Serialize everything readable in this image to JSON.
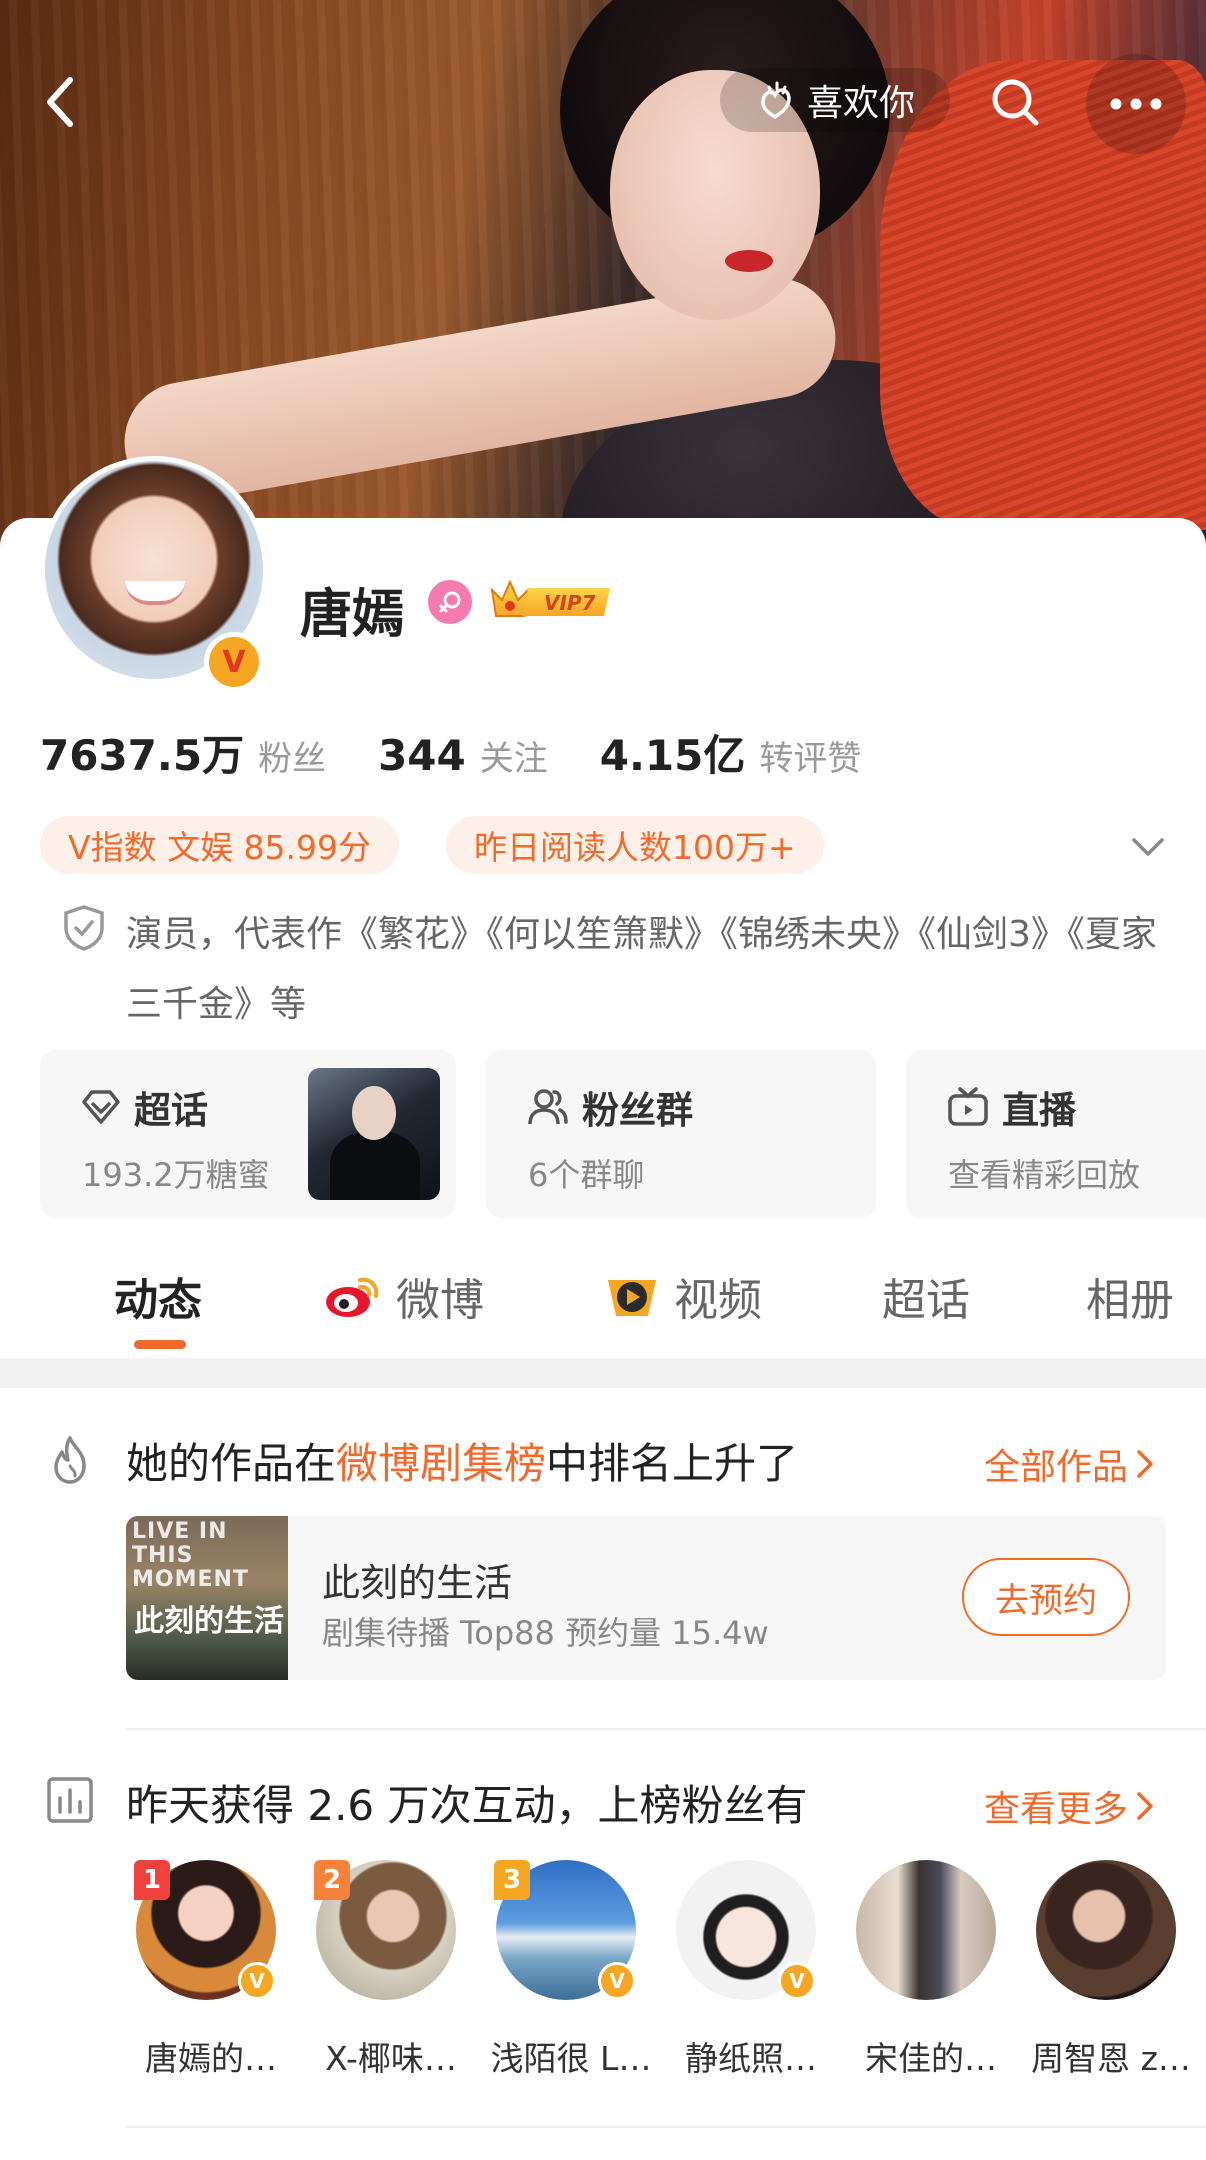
{
  "header": {
    "like_label": "喜欢你"
  },
  "profile": {
    "name": "唐嫣",
    "vip_label": "VIP7",
    "verified_badge": "V",
    "stats": [
      {
        "value": "7637.5万",
        "label": "粉丝"
      },
      {
        "value": "344",
        "label": "关注"
      },
      {
        "value": "4.15亿",
        "label": "转评赞"
      }
    ],
    "tags": [
      "V指数 文娱 85.99分",
      "昨日阅读人数100万+"
    ],
    "bio": "演员，代表作《繁花》《何以笙箫默》《锦绣未央》《仙剑3》《夏家三千金》等"
  },
  "features": [
    {
      "title": "超话",
      "subtitle": "193.2万糖蜜",
      "icon": "diamond-icon"
    },
    {
      "title": "粉丝群",
      "subtitle": "6个群聊",
      "icon": "people-icon"
    },
    {
      "title": "直播",
      "subtitle": "查看精彩回放",
      "icon": "tv-icon"
    }
  ],
  "tabs": [
    {
      "label": "动态",
      "active": true
    },
    {
      "label": "微博",
      "icon": "weibo-icon"
    },
    {
      "label": "视频",
      "icon": "video-icon"
    },
    {
      "label": "超话"
    },
    {
      "label": "相册"
    }
  ],
  "ranking_card": {
    "title_pre": "她的作品在",
    "title_highlight": "微博剧集榜",
    "title_post": "中排名上升了",
    "more_label": "全部作品",
    "work": {
      "poster_text": "LIVE IN THIS MOMENT",
      "poster_title": "此刻的生活",
      "title": "此刻的生活",
      "subtitle": "剧集待播 Top88 预约量 15.4w",
      "button_label": "去预约"
    }
  },
  "fans_card": {
    "title": "昨天获得 2.6 万次互动，上榜粉丝有",
    "more_label": "查看更多",
    "fans": [
      {
        "rank": "1",
        "name": "唐嫣的…",
        "verified": true
      },
      {
        "rank": "2",
        "name": "X-椰味…",
        "verified": false
      },
      {
        "rank": "3",
        "name": "浅陌很 L…",
        "verified": true
      },
      {
        "rank": "",
        "name": "静纸照…",
        "verified": true
      },
      {
        "rank": "",
        "name": "宋佳的…",
        "verified": false
      },
      {
        "rank": "",
        "name": "周智恩 z…",
        "verified": false
      }
    ]
  },
  "colors": {
    "accent": "#f26a2b",
    "tag_bg": "#fdf0e8",
    "verified": "#f5a623",
    "rank1": "#f0413c",
    "rank2": "#f5813a",
    "rank3": "#f5a623"
  }
}
